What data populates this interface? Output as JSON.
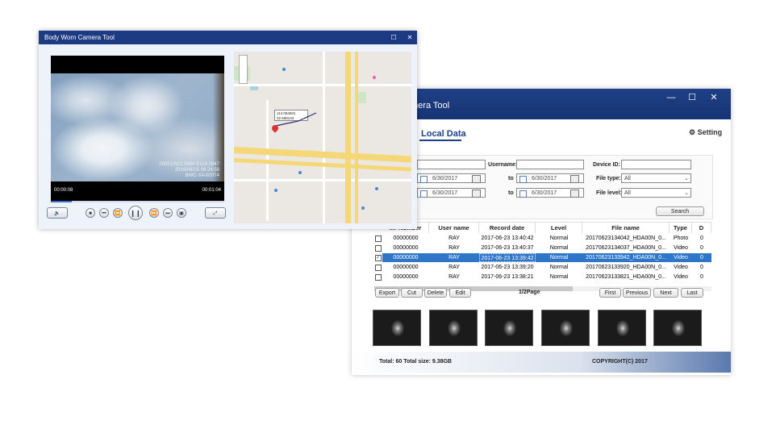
{
  "data_window": {
    "title": "mera Tool",
    "tab": "Local Data",
    "setting": "Setting",
    "search": {
      "username_label": "Username:",
      "device_label": "Device ID:",
      "to1": "to",
      "to2": "to",
      "date_a": "6/30/2017",
      "date_b": "6/30/2017",
      "date_c": "6/30/2017",
      "date_d": "6/30/2017",
      "file_type_label": "File type:",
      "file_type_value": "All",
      "file_level_label": "File level:",
      "file_level_value": "All",
      "search_button": "Search"
    },
    "table": {
      "headers": [
        "...r Number",
        "User name",
        "Record date",
        "Level",
        "File name",
        "Type",
        "D"
      ],
      "rows": [
        {
          "number": "00000000",
          "user": "RAY",
          "date": "2017-06-23 13:40:42",
          "level": "Normal",
          "file": "20170623134042_HDA00N_0...",
          "type": "Photo",
          "extra": "0"
        },
        {
          "number": "00000000",
          "user": "RAY",
          "date": "2017-06-23 13:40:37",
          "level": "Normal",
          "file": "20170623134037_HDA00N_0...",
          "type": "Video",
          "extra": "0"
        },
        {
          "number": "00000000",
          "user": "RAY",
          "date": "2017-06-23 13:39:42",
          "level": "Normal",
          "file": "20170623133942_HDA00N_0...",
          "type": "Video",
          "extra": "0"
        },
        {
          "number": "00000000",
          "user": "RAY",
          "date": "2017-06-23 13:39:20",
          "level": "Normal",
          "file": "20170623133920_HDA00N_0...",
          "type": "Video",
          "extra": "0"
        },
        {
          "number": "00000000",
          "user": "RAY",
          "date": "2017-06-23 13:38:21",
          "level": "Normal",
          "file": "20170623133821_HDA00N_0...",
          "type": "Video",
          "extra": "0"
        }
      ]
    },
    "actions": {
      "export": "Export",
      "cut": "Cut",
      "delete": "Delete",
      "edit": "Edit",
      "page": "1/2Page",
      "first": "First",
      "previous": "Previous",
      "next": "Next",
      "last": "Last"
    },
    "status": {
      "total": "Total: 60 Total size: 9.38GB",
      "copyright": "COPYRIGHT(C) 2017"
    }
  },
  "player_window": {
    "title": "Body Worn Camera Tool",
    "overlay_line1": "00001/N22.5684 E114.0947",
    "overlay_line2": "2016/06/15 06:24:58",
    "overlay_line3": "BWC-X4-000T4",
    "time_current": "00:00:08",
    "time_total": "00:01:04",
    "progress_percent": 12,
    "map_label_line1": "114.094581",
    "map_label_line2": "22.568143"
  }
}
